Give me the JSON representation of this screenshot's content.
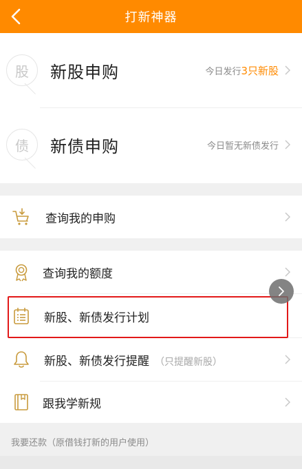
{
  "header": {
    "title": "打新神器",
    "back_icon": "chevron-left-icon",
    "bg_color": "#ff8a00"
  },
  "big_items": [
    {
      "icon_text": "股",
      "label": "新股申购",
      "note_prefix": "今日发行",
      "note_highlight": "3只新股"
    },
    {
      "icon_text": "债",
      "label": "新债申购",
      "note": "今日暂无新债发行"
    }
  ],
  "menu": [
    {
      "key": "my-subscription",
      "icon": "cart-download-icon",
      "label": "查询我的申购"
    },
    {
      "key": "my-quota",
      "icon": "award-medal-icon",
      "label": "查询我的额度"
    },
    {
      "key": "issue-plan",
      "icon": "calendar-list-icon",
      "label": "新股、新债发行计划"
    },
    {
      "key": "issue-reminder",
      "icon": "bell-icon",
      "label": "新股、新债发行提醒",
      "sub": "（只提醒新股）"
    },
    {
      "key": "learn-rules",
      "icon": "book-icon",
      "label": "跟我学新规"
    }
  ],
  "footer": {
    "repay_text": "我要还款（原借钱打新的用户使用）"
  },
  "colors": {
    "accent": "#ff8a00",
    "highlight_border": "#e21818"
  }
}
